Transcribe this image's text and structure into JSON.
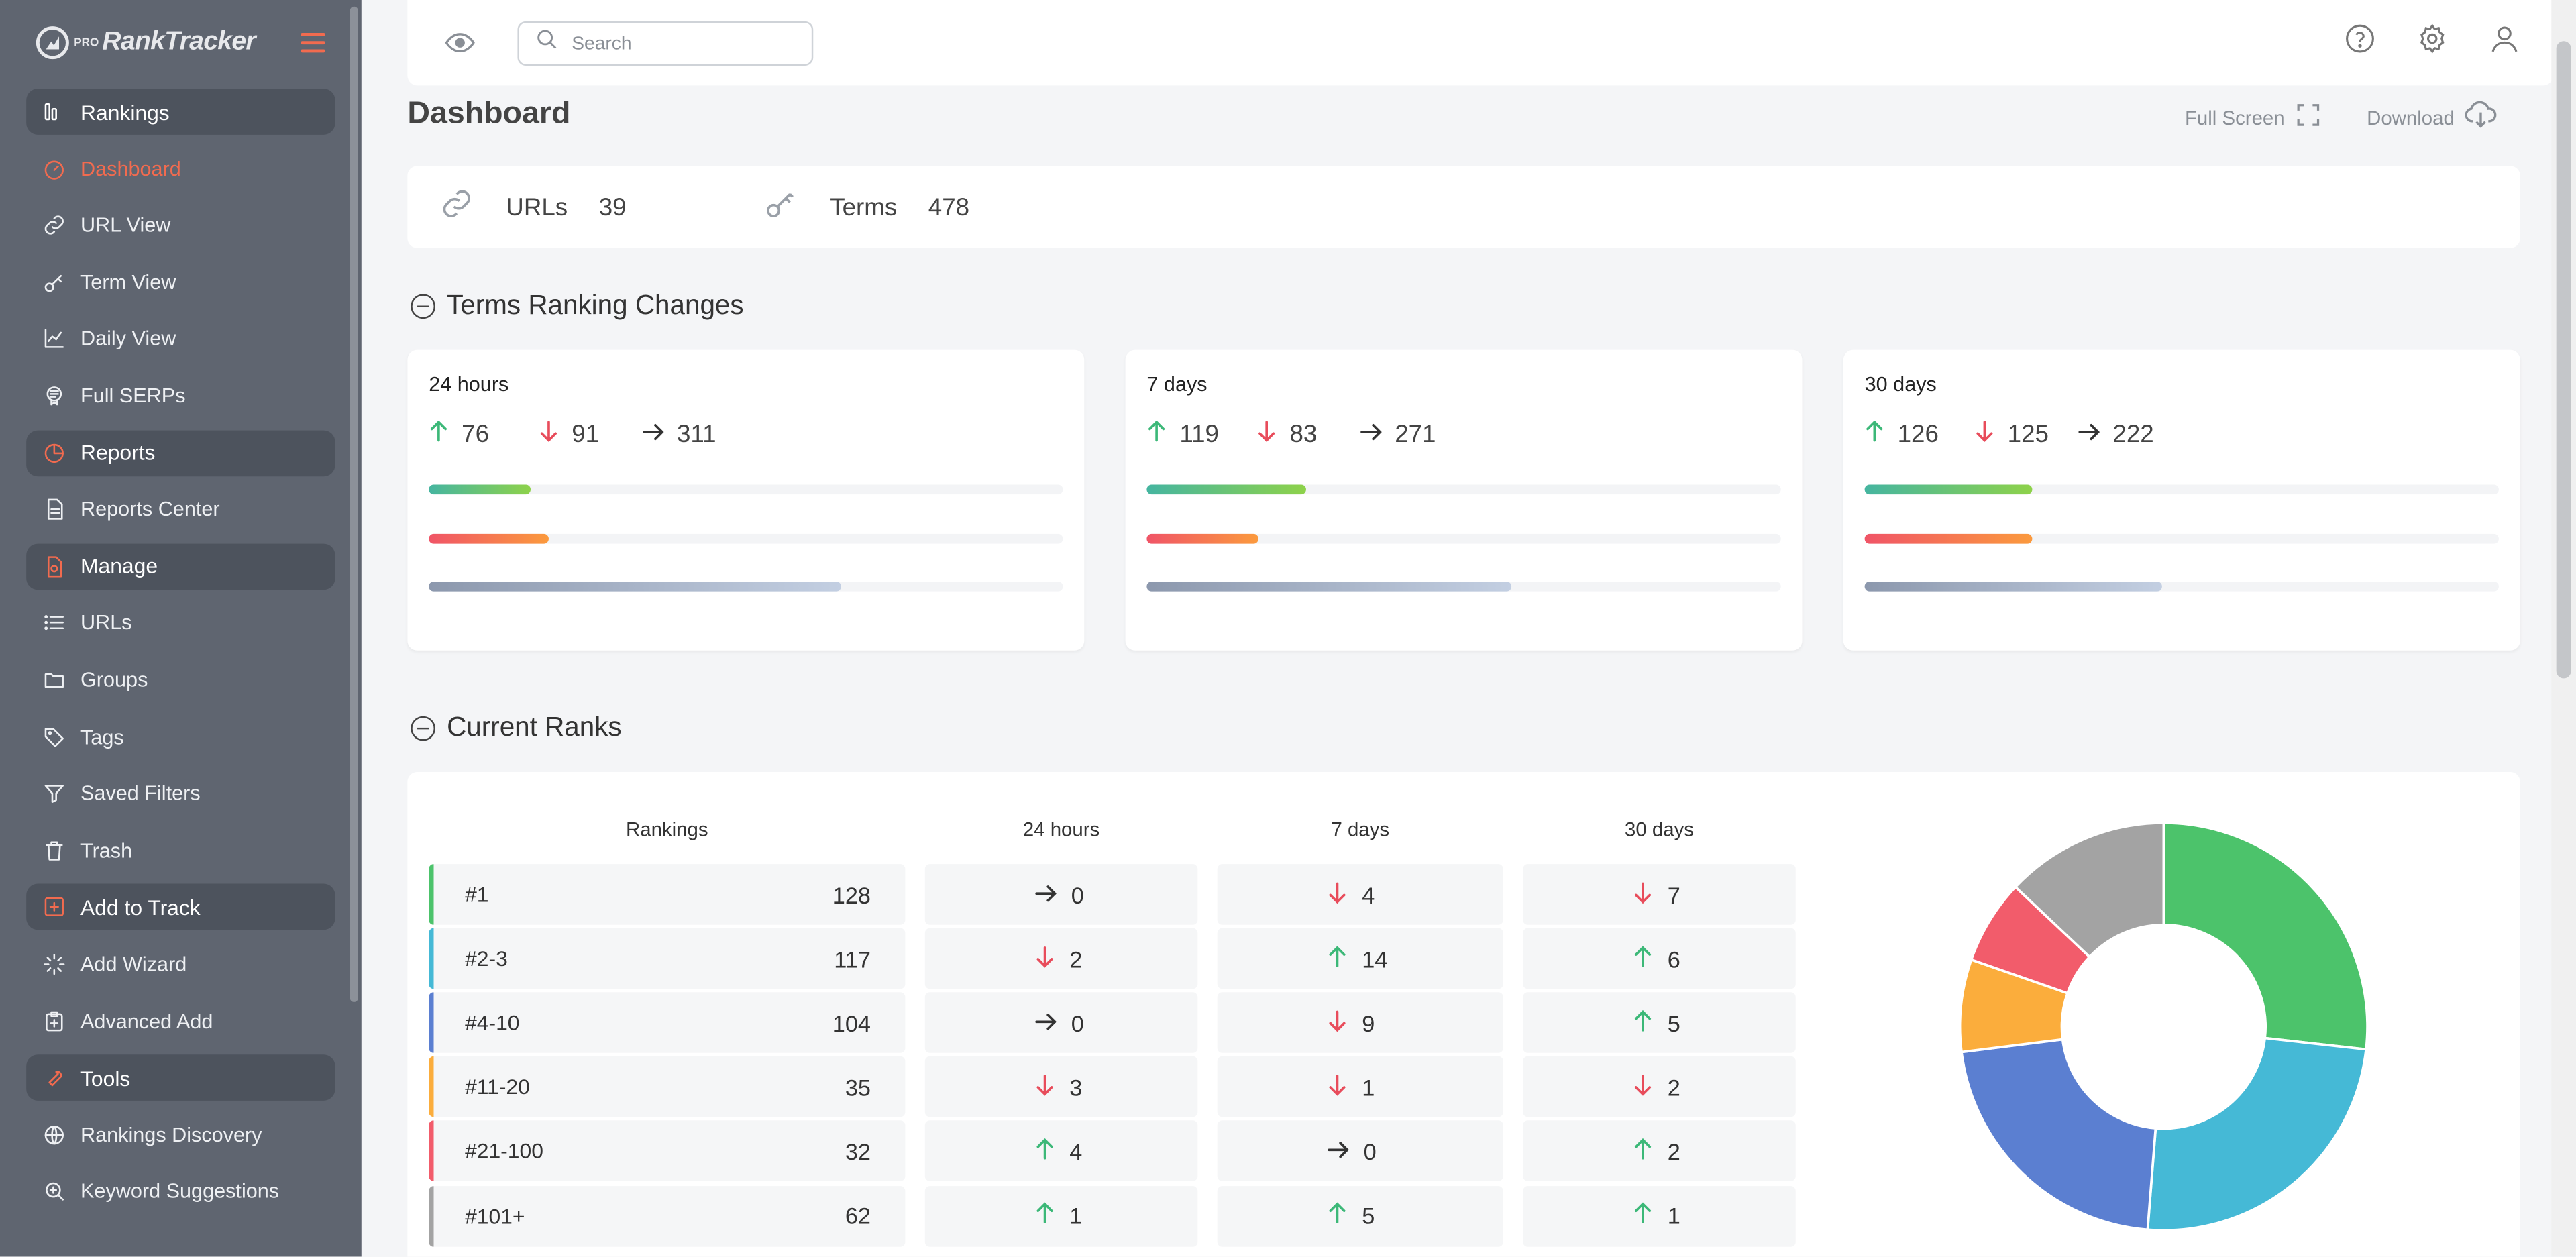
{
  "app": {
    "logo_prefix": "PRO",
    "logo_text": "RankTracker"
  },
  "sidebar": {
    "items": [
      {
        "type": "section",
        "label": "Rankings",
        "icon": "rankings-icon"
      },
      {
        "type": "item",
        "label": "Dashboard",
        "icon": "dashboard-icon",
        "active": true
      },
      {
        "type": "item",
        "label": "URL View",
        "icon": "link-icon"
      },
      {
        "type": "item",
        "label": "Term View",
        "icon": "key-icon"
      },
      {
        "type": "item",
        "label": "Daily View",
        "icon": "line-chart-icon"
      },
      {
        "type": "item",
        "label": "Full SERPs",
        "icon": "serp-icon"
      },
      {
        "type": "section",
        "label": "Reports",
        "icon": "pie-icon"
      },
      {
        "type": "item",
        "label": "Reports Center",
        "icon": "document-icon"
      },
      {
        "type": "section",
        "label": "Manage",
        "icon": "manage-icon"
      },
      {
        "type": "item",
        "label": "URLs",
        "icon": "list-icon"
      },
      {
        "type": "item",
        "label": "Groups",
        "icon": "folder-icon"
      },
      {
        "type": "item",
        "label": "Tags",
        "icon": "tag-icon"
      },
      {
        "type": "item",
        "label": "Saved Filters",
        "icon": "filter-icon"
      },
      {
        "type": "item",
        "label": "Trash",
        "icon": "trash-icon"
      },
      {
        "type": "section",
        "label": "Add to Track",
        "icon": "plus-box-icon"
      },
      {
        "type": "item",
        "label": "Add Wizard",
        "icon": "wizard-icon"
      },
      {
        "type": "item",
        "label": "Advanced Add",
        "icon": "advanced-add-icon"
      },
      {
        "type": "section",
        "label": "Tools",
        "icon": "wrench-icon"
      },
      {
        "type": "item",
        "label": "Rankings Discovery",
        "icon": "globe-icon"
      },
      {
        "type": "item",
        "label": "Keyword Suggestions",
        "icon": "search-plus-icon"
      }
    ]
  },
  "header": {
    "search_placeholder": "Search",
    "icons": [
      "help-icon",
      "settings-icon",
      "user-icon"
    ]
  },
  "page": {
    "title": "Dashboard",
    "full_screen_label": "Full Screen",
    "download_label": "Download"
  },
  "summary": {
    "urls_label": "URLs",
    "urls_count": "39",
    "terms_label": "Terms",
    "terms_count": "478"
  },
  "terms_ranking_changes": {
    "title": "Terms Ranking Changes",
    "cards": [
      {
        "title": "24 hours",
        "up": "76",
        "down": "91",
        "same": "311",
        "bars": {
          "up": 0.16,
          "down": 0.19,
          "same": 0.65
        }
      },
      {
        "title": "7 days",
        "up": "119",
        "down": "83",
        "same": "271",
        "bars": {
          "up": 0.25,
          "down": 0.175,
          "same": 0.575
        }
      },
      {
        "title": "30 days",
        "up": "126",
        "down": "125",
        "same": "222",
        "bars": {
          "up": 0.265,
          "down": 0.265,
          "same": 0.47
        }
      }
    ]
  },
  "current_ranks": {
    "title": "Current Ranks",
    "headers": {
      "rankings": "Rankings",
      "h24": "24 hours",
      "d7": "7 days",
      "d30": "30 days"
    },
    "rows": [
      {
        "label": "#1",
        "count": "128",
        "color": "#4cc36b",
        "h24": {
          "dir": "same",
          "val": "0"
        },
        "d7": {
          "dir": "down",
          "val": "4"
        },
        "d30": {
          "dir": "down",
          "val": "7"
        }
      },
      {
        "label": "#2-3",
        "count": "117",
        "color": "#45b9d6",
        "h24": {
          "dir": "down",
          "val": "2"
        },
        "d7": {
          "dir": "up",
          "val": "14"
        },
        "d30": {
          "dir": "up",
          "val": "6"
        }
      },
      {
        "label": "#4-10",
        "count": "104",
        "color": "#5b7fd1",
        "h24": {
          "dir": "same",
          "val": "0"
        },
        "d7": {
          "dir": "down",
          "val": "9"
        },
        "d30": {
          "dir": "up",
          "val": "5"
        }
      },
      {
        "label": "#11-20",
        "count": "35",
        "color": "#fbad3c",
        "h24": {
          "dir": "down",
          "val": "3"
        },
        "d7": {
          "dir": "down",
          "val": "1"
        },
        "d30": {
          "dir": "down",
          "val": "2"
        }
      },
      {
        "label": "#21-100",
        "count": "32",
        "color": "#f25c6b",
        "h24": {
          "dir": "up",
          "val": "4"
        },
        "d7": {
          "dir": "same",
          "val": "0"
        },
        "d30": {
          "dir": "up",
          "val": "2"
        }
      },
      {
        "label": "#101+",
        "count": "62",
        "color": "#a3a3a3",
        "h24": {
          "dir": "up",
          "val": "1"
        },
        "d7": {
          "dir": "up",
          "val": "5"
        },
        "d30": {
          "dir": "up",
          "val": "1"
        }
      }
    ]
  },
  "colors": {
    "accent": "#f26b4f",
    "up": "#3cb878",
    "down": "#e84c5b",
    "sidebar_bg": "#5f6570"
  },
  "chart_data": {
    "type": "pie",
    "categories": [
      "#1",
      "#2-3",
      "#4-10",
      "#11-20",
      "#21-100",
      "#101+"
    ],
    "values": [
      128,
      117,
      104,
      35,
      32,
      62
    ],
    "colors": [
      "#4cc36b",
      "#45b9d6",
      "#5b7fd1",
      "#fbad3c",
      "#f25c6b",
      "#a3a3a3"
    ],
    "donut": true,
    "title": ""
  }
}
